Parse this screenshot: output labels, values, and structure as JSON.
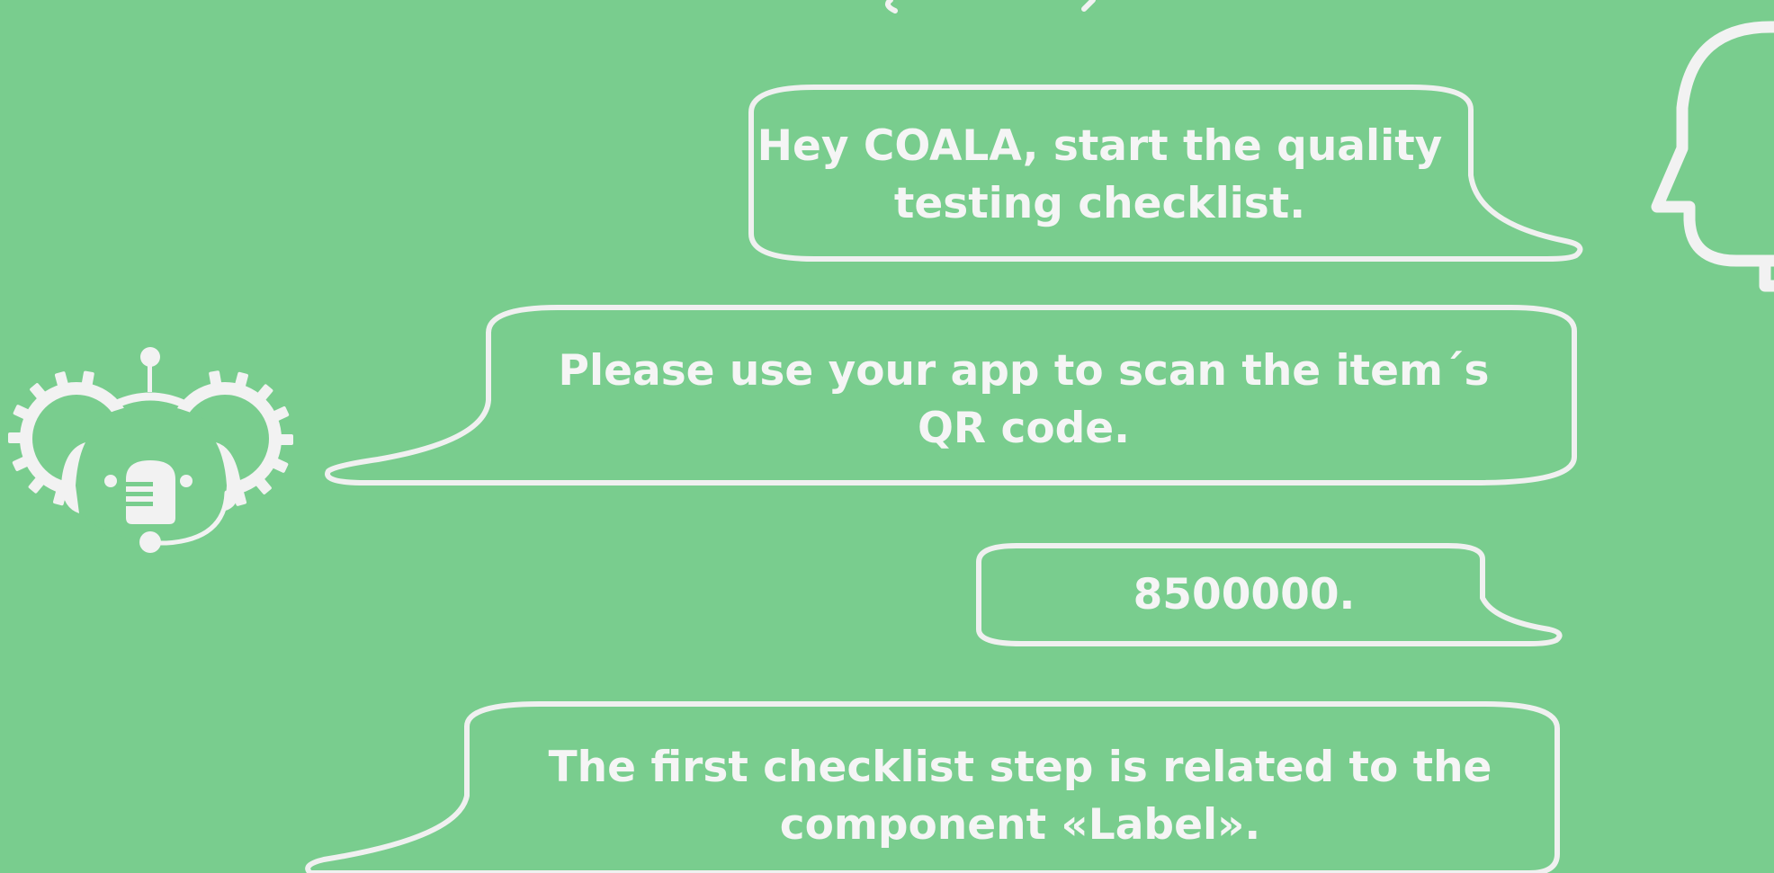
{
  "conversation": {
    "messages": [
      {
        "speaker": "user",
        "text": "Hey COALA, start the quality\ntesting checklist."
      },
      {
        "speaker": "assistant",
        "text": "Please  use your app to scan the item´s\nQR code."
      },
      {
        "speaker": "user",
        "text": "8500000."
      },
      {
        "speaker": "assistant",
        "text": "The first checklist step is related to the\ncomponent «Label»."
      }
    ]
  },
  "icons": {
    "assistant": "koala-robot-icon",
    "user": "human-head-icon"
  },
  "colors": {
    "background": "#79cd8e",
    "foreground": "#f2f2f2"
  }
}
